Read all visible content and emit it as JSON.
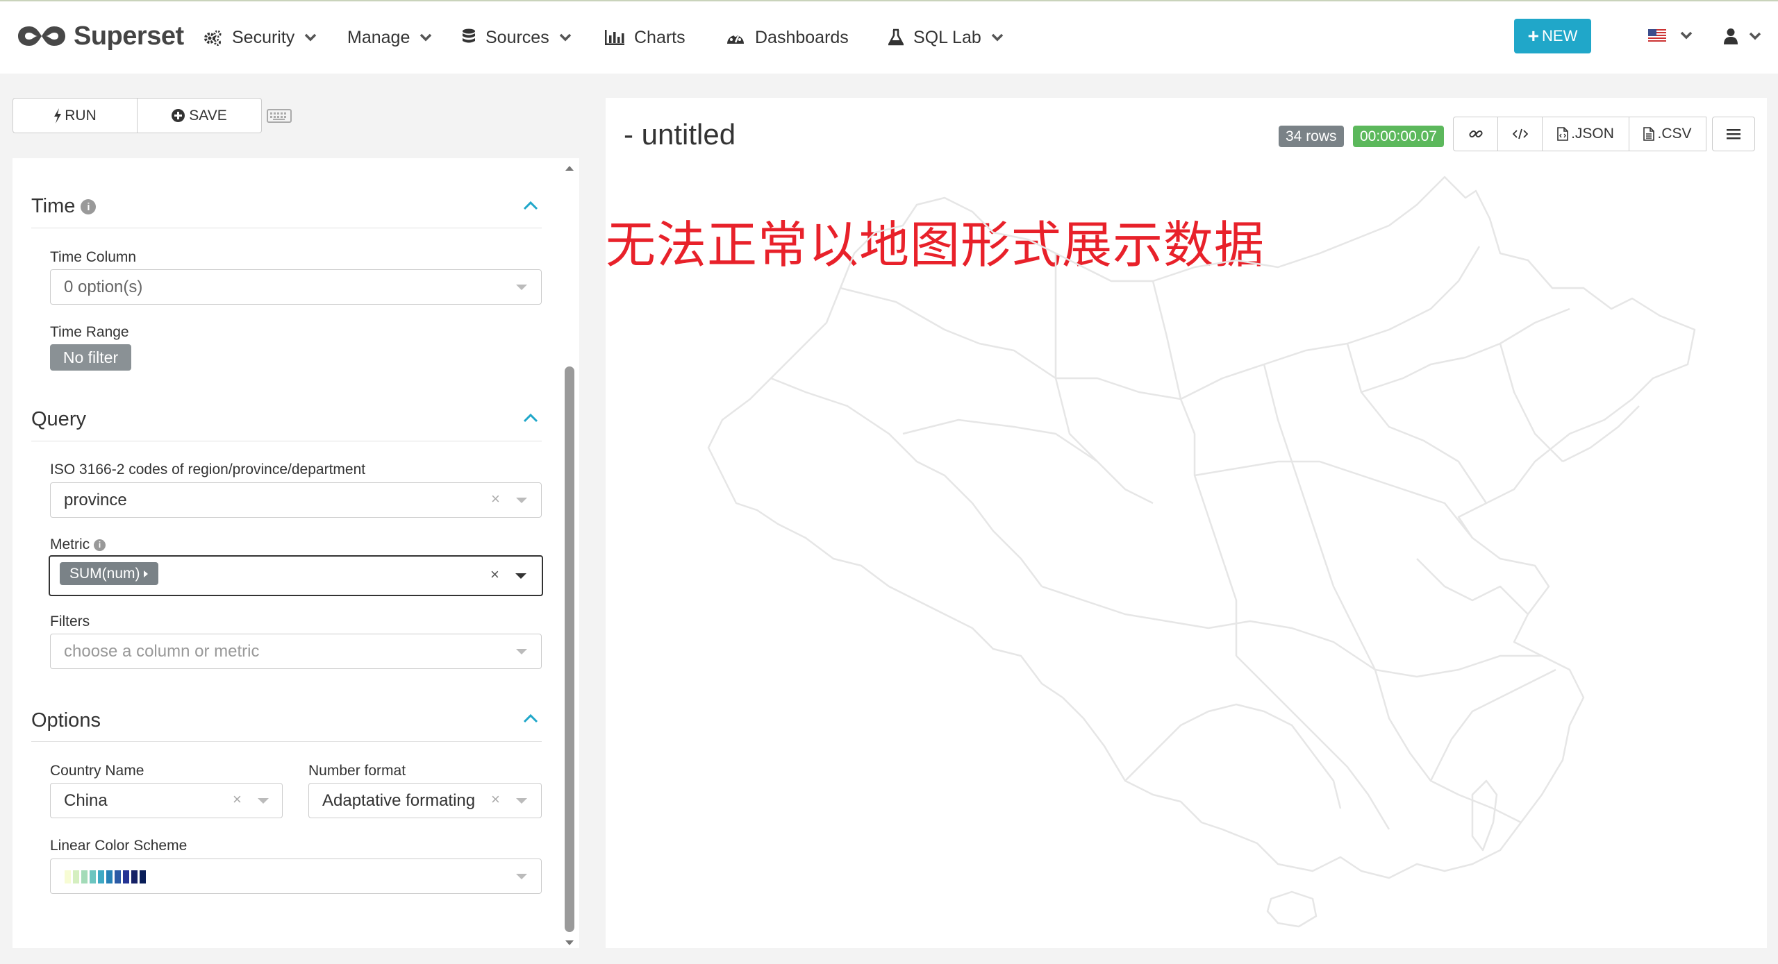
{
  "app": {
    "brand": "Superset"
  },
  "nav": {
    "items": [
      {
        "label": "Security",
        "icon": "cogs-icon",
        "has_dropdown": true
      },
      {
        "label": "Manage",
        "icon": "",
        "has_dropdown": true
      },
      {
        "label": "Sources",
        "icon": "database-icon",
        "has_dropdown": true
      },
      {
        "label": "Charts",
        "icon": "bar-chart-icon",
        "has_dropdown": false
      },
      {
        "label": "Dashboards",
        "icon": "dashboard-icon",
        "has_dropdown": false
      },
      {
        "label": "SQL Lab",
        "icon": "flask-icon",
        "has_dropdown": true
      }
    ],
    "new_button": "NEW",
    "language_icon": "us-flag-icon",
    "user_icon": "user-icon"
  },
  "toolbar": {
    "run_label": "RUN",
    "save_label": "SAVE",
    "keyboard_icon": "keyboard-icon"
  },
  "controls": {
    "time": {
      "title": "Time",
      "time_column_label": "Time Column",
      "time_column_value": "0 option(s)",
      "time_range_label": "Time Range",
      "time_range_value": "No filter"
    },
    "query": {
      "title": "Query",
      "iso_label": "ISO 3166-2 codes of region/province/department",
      "iso_value": "province",
      "metric_label": "Metric",
      "metric_value": "SUM(num)",
      "filters_label": "Filters",
      "filters_placeholder": "choose a column or metric"
    },
    "options": {
      "title": "Options",
      "country_label": "Country Name",
      "country_value": "China",
      "number_format_label": "Number format",
      "number_format_value": "Adaptative formating",
      "color_scheme_label": "Linear Color Scheme",
      "color_scheme_swatches": [
        "#f7fcd4",
        "#d5efc0",
        "#a3dbb8",
        "#6cc5bf",
        "#3ea9c4",
        "#2781b6",
        "#2b5aa5",
        "#253494",
        "#152166",
        "#081d58"
      ]
    }
  },
  "chart": {
    "title": "- untitled",
    "rows_label": "34 rows",
    "duration": "00:00:00.07",
    "json_label": ".JSON",
    "csv_label": ".CSV",
    "annotation": "无法正常以地图形式展示数据",
    "map_stroke": "#e6e6e6"
  }
}
